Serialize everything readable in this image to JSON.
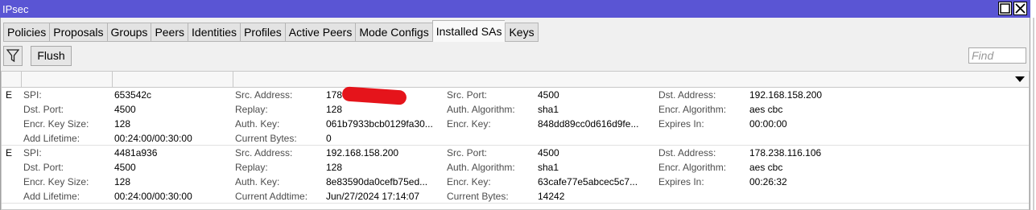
{
  "window": {
    "title": "IPsec"
  },
  "tabs": [
    "Policies",
    "Proposals",
    "Groups",
    "Peers",
    "Identities",
    "Profiles",
    "Active Peers",
    "Mode Configs",
    "Installed SAs",
    "Keys"
  ],
  "active_tab": "Installed SAs",
  "toolbar": {
    "flush_label": "Flush",
    "find_placeholder": "Find"
  },
  "rows": [
    {
      "flag": "E",
      "cells": [
        [
          "SPI:",
          "653542c",
          "Src. Address:",
          "178",
          "Src. Port:",
          "4500",
          "Dst. Address:",
          "192.168.158.200"
        ],
        [
          "Dst. Port:",
          "4500",
          "Replay:",
          "128",
          "Auth. Algorithm:",
          "sha1",
          "Encr. Algorithm:",
          "aes cbc"
        ],
        [
          "Encr. Key Size:",
          "128",
          "Auth. Key:",
          "061b7933bcb0129fa30...",
          "Encr. Key:",
          "848dd89cc0d616d9fe...",
          "Expires In:",
          "00:00:00"
        ],
        [
          "Add Lifetime:",
          "00:24:00/00:30:00",
          "Current Bytes:",
          "0"
        ]
      ]
    },
    {
      "flag": "E",
      "cells": [
        [
          "SPI:",
          "4481a936",
          "Src. Address:",
          "192.168.158.200",
          "Src. Port:",
          "4500",
          "Dst. Address:",
          "178.238.116.106"
        ],
        [
          "Dst. Port:",
          "4500",
          "Replay:",
          "128",
          "Auth. Algorithm:",
          "sha1",
          "Encr. Algorithm:",
          "aes cbc"
        ],
        [
          "Encr. Key Size:",
          "128",
          "Auth. Key:",
          "8e83590da0cefb75ed...",
          "Encr. Key:",
          "63cafe77e5abcec5c7...",
          "Expires In:",
          "00:26:32"
        ],
        [
          "Add Lifetime:",
          "00:24:00/00:30:00",
          "Current Addtime:",
          "Jun/27/2024 17:14:07",
          "Current Bytes:",
          "14242"
        ]
      ]
    }
  ],
  "colors": {
    "titlebar": "#5a55d4",
    "redaction": "#e5141b"
  }
}
